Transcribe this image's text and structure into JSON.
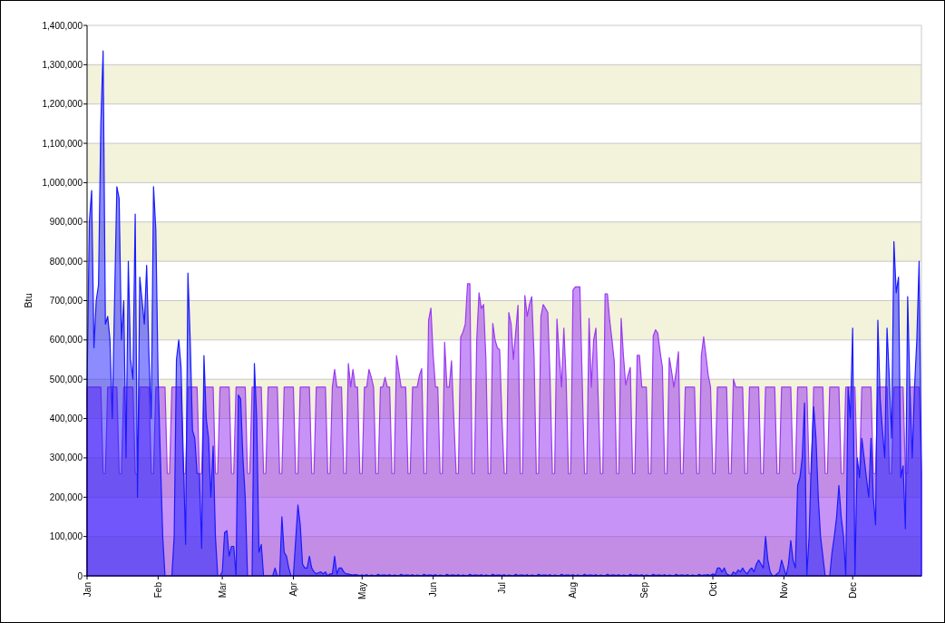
{
  "chart": {
    "chart_data": {
      "type": "area",
      "ylabel": "Btu",
      "categories": [
        "Jan",
        null,
        null,
        null,
        null,
        null,
        null,
        null,
        null,
        null,
        null,
        null,
        null,
        null,
        null,
        null,
        null,
        null,
        null,
        null,
        null,
        null,
        null,
        null,
        null,
        null,
        null,
        null,
        null,
        null,
        null,
        "Feb",
        null,
        null,
        null,
        null,
        null,
        null,
        null,
        null,
        null,
        null,
        null,
        null,
        null,
        null,
        null,
        null,
        null,
        null,
        null,
        null,
        null,
        null,
        null,
        null,
        null,
        null,
        null,
        "Mar",
        null,
        null,
        null,
        null,
        null,
        null,
        null,
        null,
        null,
        null,
        null,
        null,
        null,
        null,
        null,
        null,
        null,
        null,
        null,
        null,
        null,
        null,
        null,
        null,
        null,
        null,
        null,
        null,
        null,
        null,
        "Apr",
        null,
        null,
        null,
        null,
        null,
        null,
        null,
        null,
        null,
        null,
        null,
        null,
        null,
        null,
        null,
        null,
        null,
        null,
        null,
        null,
        null,
        null,
        null,
        null,
        null,
        null,
        null,
        null,
        null,
        "May",
        null,
        null,
        null,
        null,
        null,
        null,
        null,
        null,
        null,
        null,
        null,
        null,
        null,
        null,
        null,
        null,
        null,
        null,
        null,
        null,
        null,
        null,
        null,
        null,
        null,
        null,
        null,
        null,
        null,
        null,
        "Jun",
        null,
        null,
        null,
        null,
        null,
        null,
        null,
        null,
        null,
        null,
        null,
        null,
        null,
        null,
        null,
        null,
        null,
        null,
        null,
        null,
        null,
        null,
        null,
        null,
        null,
        null,
        null,
        null,
        null,
        "Jul",
        null,
        null,
        null,
        null,
        null,
        null,
        null,
        null,
        null,
        null,
        null,
        null,
        null,
        null,
        null,
        null,
        null,
        null,
        null,
        null,
        null,
        null,
        null,
        null,
        null,
        null,
        null,
        null,
        null,
        null,
        "Aug",
        null,
        null,
        null,
        null,
        null,
        null,
        null,
        null,
        null,
        null,
        null,
        null,
        null,
        null,
        null,
        null,
        null,
        null,
        null,
        null,
        null,
        null,
        null,
        null,
        null,
        null,
        null,
        null,
        null,
        null,
        "Sep",
        null,
        null,
        null,
        null,
        null,
        null,
        null,
        null,
        null,
        null,
        null,
        null,
        null,
        null,
        null,
        null,
        null,
        null,
        null,
        null,
        null,
        null,
        null,
        null,
        null,
        null,
        null,
        null,
        null,
        "Oct",
        null,
        null,
        null,
        null,
        null,
        null,
        null,
        null,
        null,
        null,
        null,
        null,
        null,
        null,
        null,
        null,
        null,
        null,
        null,
        null,
        null,
        null,
        null,
        null,
        null,
        null,
        null,
        null,
        null,
        null,
        "Nov",
        null,
        null,
        null,
        null,
        null,
        null,
        null,
        null,
        null,
        null,
        null,
        null,
        null,
        null,
        null,
        null,
        null,
        null,
        null,
        null,
        null,
        null,
        null,
        null,
        null,
        null,
        null,
        null,
        null,
        "Dec",
        null,
        null,
        null,
        null,
        null,
        null,
        null,
        null,
        null,
        null,
        null,
        null,
        null,
        null,
        null,
        null,
        null,
        null,
        null,
        null,
        null,
        null,
        null,
        null,
        null,
        null,
        null,
        null,
        null,
        null
      ],
      "ylim": [
        0,
        1400000
      ],
      "stacked": false,
      "grid": true,
      "yticks": [
        {
          "value": 0,
          "label": "0"
        },
        {
          "value": 100000,
          "label": "100,000"
        },
        {
          "value": 200000,
          "label": "200,000"
        },
        {
          "value": 300000,
          "label": "300,000"
        },
        {
          "value": 400000,
          "label": "400,000"
        },
        {
          "value": 500000,
          "label": "500,000"
        },
        {
          "value": 600000,
          "label": "600,000"
        },
        {
          "value": 700000,
          "label": "700,000"
        },
        {
          "value": 800000,
          "label": "800,000"
        },
        {
          "value": 900000,
          "label": "900,000"
        },
        {
          "value": 1000000,
          "label": "1,000,000"
        },
        {
          "value": 1100000,
          "label": "1,100,000"
        },
        {
          "value": 1200000,
          "label": "1,200,000"
        },
        {
          "value": 1300000,
          "label": "1,300,000"
        },
        {
          "value": 1400000,
          "label": "1,400,000"
        }
      ],
      "series": [
        {
          "color": "#9a3af0",
          "values": [
            480000,
            480000,
            480000,
            480000,
            480000,
            480000,
            480000,
            260000,
            260000,
            480000,
            480000,
            480000,
            480000,
            480000,
            260000,
            260000,
            480000,
            480000,
            480000,
            480000,
            480000,
            260000,
            260000,
            480000,
            480000,
            480000,
            480000,
            480000,
            260000,
            260000,
            480000,
            480000,
            480000,
            480000,
            480000,
            260000,
            260000,
            480000,
            480000,
            480000,
            480000,
            480000,
            260000,
            260000,
            480000,
            480000,
            480000,
            480000,
            480000,
            260000,
            260000,
            480000,
            480000,
            480000,
            480000,
            480000,
            260000,
            260000,
            480000,
            480000,
            480000,
            480000,
            480000,
            260000,
            260000,
            480000,
            480000,
            480000,
            480000,
            480000,
            260000,
            260000,
            480000,
            480000,
            480000,
            480000,
            480000,
            260000,
            260000,
            480000,
            480000,
            480000,
            480000,
            480000,
            260000,
            260000,
            480000,
            480000,
            480000,
            480000,
            480000,
            260000,
            260000,
            480000,
            480000,
            480000,
            480000,
            480000,
            260000,
            260000,
            480000,
            480000,
            480000,
            480000,
            480000,
            260000,
            260000,
            480000,
            525000,
            480000,
            480000,
            480000,
            260000,
            260000,
            540000,
            480000,
            525000,
            480000,
            480000,
            260000,
            260000,
            480000,
            480000,
            525000,
            505000,
            480000,
            260000,
            260000,
            480000,
            480000,
            505000,
            480000,
            480000,
            260000,
            260000,
            560000,
            520000,
            480000,
            480000,
            480000,
            260000,
            260000,
            480000,
            480000,
            480000,
            510000,
            527000,
            260000,
            260000,
            650000,
            681000,
            560000,
            480000,
            480000,
            260000,
            260000,
            594000,
            480000,
            480000,
            547000,
            400000,
            260000,
            260000,
            607000,
            620000,
            640000,
            743000,
            743000,
            260000,
            260000,
            600000,
            720000,
            680000,
            690000,
            550000,
            260000,
            260000,
            642000,
            600000,
            580000,
            575000,
            400000,
            260000,
            260000,
            670000,
            640000,
            550000,
            620000,
            688000,
            260000,
            260000,
            713000,
            660000,
            690000,
            710000,
            560000,
            260000,
            260000,
            660000,
            690000,
            680000,
            670000,
            500000,
            260000,
            260000,
            653000,
            560000,
            480000,
            630000,
            500000,
            260000,
            260000,
            727000,
            735000,
            735000,
            735000,
            500000,
            260000,
            260000,
            655000,
            480000,
            600000,
            630000,
            450000,
            260000,
            260000,
            717000,
            717000,
            650000,
            600000,
            545000,
            260000,
            260000,
            655000,
            560000,
            485000,
            510000,
            530000,
            260000,
            260000,
            561000,
            561000,
            480000,
            480000,
            480000,
            260000,
            260000,
            610000,
            626000,
            617000,
            570000,
            530000,
            260000,
            260000,
            555000,
            520000,
            480000,
            520000,
            570000,
            260000,
            260000,
            480000,
            480000,
            480000,
            480000,
            480000,
            260000,
            260000,
            560000,
            608000,
            560000,
            510000,
            480000,
            260000,
            260000,
            480000,
            480000,
            480000,
            480000,
            480000,
            260000,
            260000,
            500000,
            480000,
            480000,
            480000,
            480000,
            260000,
            260000,
            480000,
            480000,
            480000,
            480000,
            480000,
            260000,
            260000,
            480000,
            480000,
            480000,
            480000,
            480000,
            260000,
            260000,
            480000,
            480000,
            480000,
            480000,
            480000,
            260000,
            260000,
            480000,
            480000,
            480000,
            480000,
            480000,
            260000,
            260000,
            480000,
            480000,
            480000,
            480000,
            480000,
            260000,
            260000,
            480000,
            480000,
            480000,
            480000,
            480000,
            260000,
            260000,
            480000,
            480000,
            480000,
            480000,
            480000,
            260000,
            260000,
            480000,
            480000,
            480000,
            480000,
            480000,
            260000,
            260000,
            480000,
            480000,
            480000,
            480000,
            480000,
            260000,
            260000,
            480000,
            480000,
            480000,
            480000,
            480000,
            260000,
            260000,
            480000,
            480000,
            480000,
            480000,
            480000,
            260000
          ]
        },
        {
          "color": "#1a1aff",
          "values": [
            480000,
            900000,
            980000,
            580000,
            700000,
            740000,
            1150000,
            1335000,
            640000,
            660000,
            600000,
            400000,
            700000,
            990000,
            960000,
            600000,
            700000,
            300000,
            800000,
            550000,
            500000,
            920000,
            200000,
            760000,
            700000,
            640000,
            790000,
            560000,
            400000,
            990000,
            880000,
            500000,
            300000,
            100000,
            0,
            0,
            0,
            0,
            100000,
            550000,
            600000,
            530000,
            300000,
            80000,
            770000,
            600000,
            370000,
            350000,
            260000,
            260000,
            70000,
            560000,
            400000,
            350000,
            200000,
            330000,
            100000,
            0,
            0,
            10000,
            110000,
            115000,
            50000,
            75000,
            75000,
            0,
            460000,
            450000,
            300000,
            200000,
            0,
            0,
            0,
            540000,
            400000,
            60000,
            80000,
            0,
            0,
            0,
            0,
            0,
            20000,
            0,
            0,
            150000,
            60000,
            50000,
            20000,
            0,
            0,
            90000,
            180000,
            130000,
            30000,
            20000,
            20000,
            50000,
            20000,
            10000,
            5000,
            8000,
            10000,
            5000,
            10000,
            0,
            5000,
            5000,
            50000,
            5000,
            20000,
            20000,
            10000,
            5000,
            5000,
            3000,
            2000,
            3000,
            2000,
            1000,
            2000,
            1000,
            3000,
            0,
            2000,
            1000,
            0,
            4000,
            1000,
            2000,
            2000,
            1000,
            3000,
            0,
            2000,
            1000,
            0,
            4000,
            1000,
            2000,
            2000,
            1000,
            3000,
            0,
            2000,
            1000,
            0,
            4000,
            1000,
            2000,
            2000,
            1000,
            3000,
            0,
            2000,
            1000,
            0,
            4000,
            1000,
            2000,
            2000,
            1000,
            3000,
            0,
            2000,
            1000,
            0,
            4000,
            1000,
            2000,
            2000,
            1000,
            3000,
            0,
            2000,
            1000,
            0,
            4000,
            1000,
            2000,
            2000,
            1000,
            3000,
            0,
            2000,
            1000,
            0,
            4000,
            1000,
            2000,
            2000,
            1000,
            3000,
            0,
            2000,
            1000,
            0,
            4000,
            1000,
            2000,
            2000,
            1000,
            3000,
            0,
            2000,
            1000,
            0,
            4000,
            1000,
            2000,
            2000,
            1000,
            3000,
            0,
            2000,
            1000,
            0,
            4000,
            1000,
            2000,
            2000,
            1000,
            3000,
            0,
            2000,
            1000,
            0,
            4000,
            1000,
            2000,
            2000,
            1000,
            3000,
            0,
            2000,
            1000,
            0,
            4000,
            1000,
            2000,
            2000,
            1000,
            3000,
            0,
            2000,
            1000,
            0,
            4000,
            1000,
            2000,
            2000,
            1000,
            3000,
            0,
            2000,
            1000,
            0,
            4000,
            1000,
            2000,
            2000,
            1000,
            3000,
            0,
            2000,
            1000,
            0,
            4000,
            1000,
            2000,
            2000,
            3000,
            1000,
            5000,
            2000,
            20000,
            20000,
            10000,
            20000,
            5000,
            2000,
            1000,
            10000,
            5000,
            15000,
            10000,
            20000,
            10000,
            5000,
            15000,
            20000,
            10000,
            30000,
            40000,
            30000,
            20000,
            100000,
            40000,
            10000,
            0,
            0,
            5000,
            10000,
            40000,
            20000,
            0,
            30000,
            90000,
            40000,
            20000,
            230000,
            250000,
            300000,
            440000,
            0,
            100000,
            300000,
            430000,
            350000,
            200000,
            100000,
            50000,
            0,
            0,
            0,
            60000,
            100000,
            150000,
            230000,
            150000,
            100000,
            0,
            480000,
            400000,
            630000,
            0,
            300000,
            250000,
            350000,
            300000,
            250000,
            200000,
            350000,
            200000,
            130000,
            650000,
            450000,
            370000,
            300000,
            630000,
            500000,
            350000,
            850000,
            720000,
            760000,
            250000,
            280000,
            120000,
            710000,
            470000,
            300000,
            480000,
            600000,
            800000,
            260000
          ]
        }
      ]
    }
  }
}
